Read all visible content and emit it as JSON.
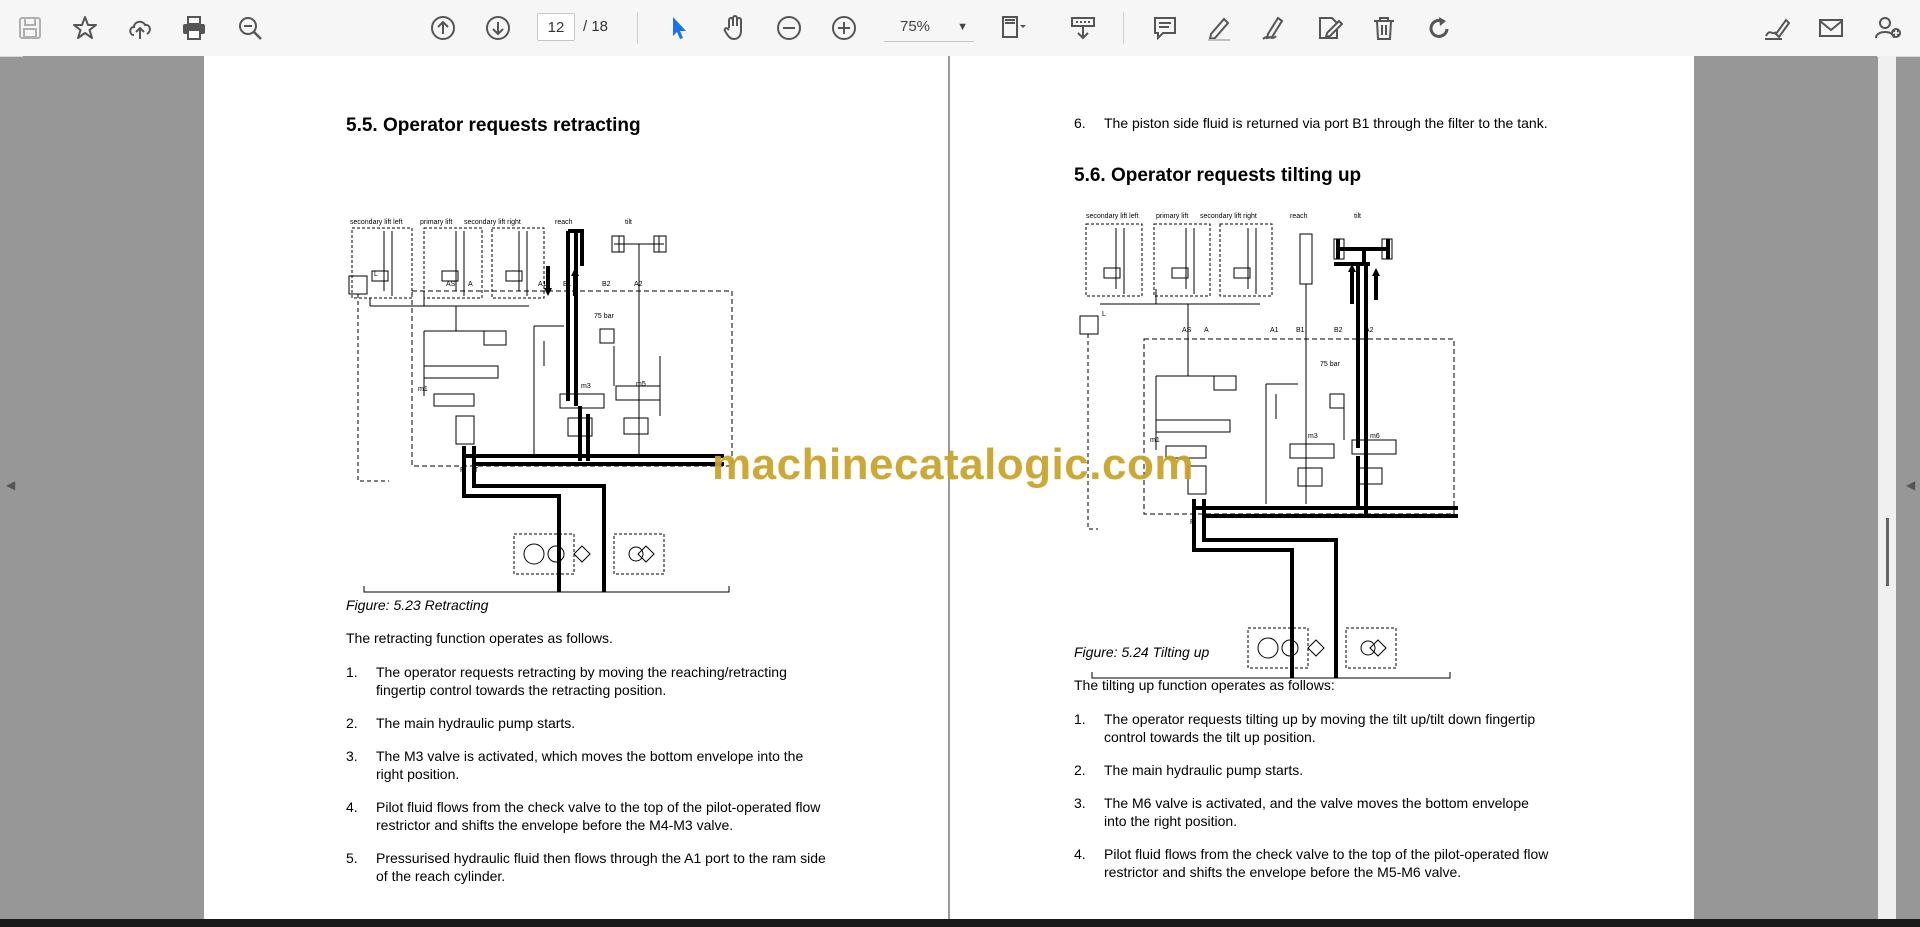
{
  "toolbar": {
    "icons": [
      "save-icon",
      "bookmark-star-icon",
      "upload-cloud-icon",
      "print-icon",
      "search-zoom-icon",
      "page-up-icon",
      "page-down-icon",
      "select-cursor-icon",
      "hand-tool-icon",
      "zoom-out-icon",
      "zoom-in-icon",
      "fit-page-icon",
      "scroll-mode-icon",
      "comment-icon",
      "highlight-pen-icon",
      "draw-icon",
      "stamp-icon",
      "delete-icon",
      "rotate-icon",
      "sign-icon",
      "mail-icon",
      "add-user-icon"
    ],
    "current_page": "12",
    "total_pages": "/ 18",
    "zoom": "75%"
  },
  "watermark": "machinecatalogic.com",
  "left_page": {
    "heading": "5.5. Operator requests retracting",
    "diagram_labels": {
      "sec_left": "secondary lift left",
      "primary": "primary lift",
      "sec_right": "secondary lift right",
      "reach": "reach",
      "tilt": "tilt",
      "as": "AS",
      "a": "A",
      "a1": "A1",
      "b1": "B1",
      "b2": "B2",
      "a2": "A2",
      "bar": "75 bar",
      "m1": "m1",
      "m3": "m3",
      "m5": "m5",
      "p": "P",
      "t": "T",
      "l": "L"
    },
    "figure_caption": "Figure: 5.23 Retracting",
    "intro": "The retracting function operates as follows.",
    "items": [
      {
        "n": "1.",
        "text": "The operator requests retracting by moving the reaching/retracting fingertip control towards the retracting position."
      },
      {
        "n": "2.",
        "text": "The main hydraulic pump starts."
      },
      {
        "n": "3.",
        "text": "The M3 valve is activated, which moves the bottom envelope into the right position."
      },
      {
        "n": "4.",
        "text": "Pilot fluid flows from the check valve to the top of the pilot-operated flow restrictor and shifts the envelope before the M4-M3 valve."
      },
      {
        "n": "5.",
        "text": "Pressurised hydraulic fluid then flows through the A1 port to the ram side of the reach cylinder."
      }
    ]
  },
  "right_page": {
    "top_item": {
      "n": "6.",
      "text": "The piston side fluid is returned via port B1 through the filter to the tank."
    },
    "heading": "5.6. Operator requests tilting up",
    "diagram_labels": {
      "sec_left": "secondary lift left",
      "primary": "primary lift",
      "sec_right": "secondary lift right",
      "reach": "reach",
      "tilt": "tilt",
      "as": "AS",
      "a": "A",
      "a1": "A1",
      "b1": "B1",
      "b2": "B2",
      "a2": "A2",
      "bar": "75 bar",
      "m1": "m1",
      "m3": "m3",
      "m6": "m6",
      "p": "P",
      "t": "T",
      "l": "L"
    },
    "figure_caption": "Figure: 5.24 Tilting up",
    "intro": "The tilting up function operates as follows:",
    "items": [
      {
        "n": "1.",
        "text": "The operator requests tilting up by moving the tilt up/tilt down fingertip control towards the tilt up position."
      },
      {
        "n": "2.",
        "text": "The main hydraulic pump starts."
      },
      {
        "n": "3.",
        "text": "The M6 valve is activated, and the valve moves the bottom envelope into the right position."
      },
      {
        "n": "4.",
        "text": "Pilot fluid flows from the check valve to the top of the pilot-operated flow restrictor and shifts the envelope before the M5-M6 valve."
      }
    ]
  }
}
